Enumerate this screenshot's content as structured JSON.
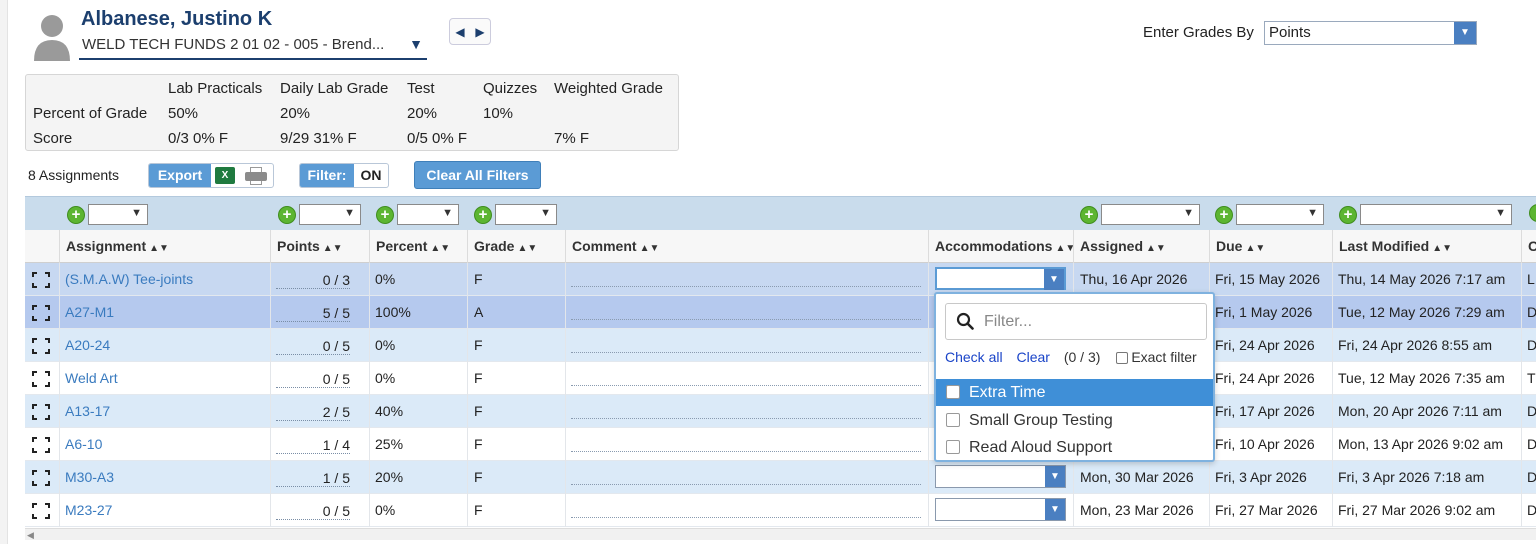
{
  "student": {
    "name": "Albanese, Justino K",
    "class_selector": "WELD TECH FUNDS 2 01 02 - 005 - Brend..."
  },
  "grades_by": {
    "label": "Enter Grades By",
    "value": "Points"
  },
  "summary": {
    "columns": [
      "Lab Practicals",
      "Daily Lab Grade",
      "Test",
      "Quizzes",
      "Weighted Grade"
    ],
    "percent_label": "Percent of Grade",
    "percents": [
      "50%",
      "20%",
      "20%",
      "10%",
      ""
    ],
    "score_label": "Score",
    "scores": [
      "0/3 0% F",
      "9/29 31% F",
      "0/5 0% F",
      "",
      "7% F"
    ]
  },
  "toolbar": {
    "assignment_count": "8 Assignments",
    "export_label": "Export",
    "excel_icon_text": "X",
    "filter_label": "Filter:",
    "filter_state": "ON",
    "clear_filters_label": "Clear All Filters"
  },
  "columns": [
    "Assignment",
    "Points",
    "Percent",
    "Grade",
    "Comment",
    "Accommodations",
    "Assigned",
    "Due",
    "Last Modified",
    "C"
  ],
  "rows": [
    {
      "assignment": "(S.M.A.W) Tee-joints",
      "points": "0 / 3",
      "percent": "0%",
      "grade": "F",
      "assigned": "Thu, 16 Apr 2026",
      "due": "Fri, 15 May 2026",
      "modified": "Thu, 14 May 2026 7:17 am",
      "cat": "L"
    },
    {
      "assignment": "A27-M1",
      "points": "5 / 5",
      "percent": "100%",
      "grade": "A",
      "assigned": "",
      "due": "Fri, 1 May 2026",
      "modified": "Tue, 12 May 2026 7:29 am",
      "cat": "D"
    },
    {
      "assignment": "A20-24",
      "points": "0 / 5",
      "percent": "0%",
      "grade": "F",
      "assigned": "",
      "due": "Fri, 24 Apr 2026",
      "modified": "Fri, 24 Apr 2026 8:55 am",
      "cat": "D"
    },
    {
      "assignment": "Weld Art",
      "points": "0 / 5",
      "percent": "0%",
      "grade": "F",
      "assigned": "",
      "due": "Fri, 24 Apr 2026",
      "modified": "Tue, 12 May 2026 7:35 am",
      "cat": "T"
    },
    {
      "assignment": "A13-17",
      "points": "2 / 5",
      "percent": "40%",
      "grade": "F",
      "assigned": "",
      "due": "Fri, 17 Apr 2026",
      "modified": "Mon, 20 Apr 2026 7:11 am",
      "cat": "D"
    },
    {
      "assignment": "A6-10",
      "points": "1 / 4",
      "percent": "25%",
      "grade": "F",
      "assigned": "",
      "due": "Fri, 10 Apr 2026",
      "modified": "Mon, 13 Apr 2026 9:02 am",
      "cat": "D"
    },
    {
      "assignment": "M30-A3",
      "points": "1 / 5",
      "percent": "20%",
      "grade": "F",
      "assigned": "Mon, 30 Mar 2026",
      "due": "Fri, 3 Apr 2026",
      "modified": "Fri, 3 Apr 2026 7:18 am",
      "cat": "D"
    },
    {
      "assignment": "M23-27",
      "points": "0 / 5",
      "percent": "0%",
      "grade": "F",
      "assigned": "Mon, 23 Mar 2026",
      "due": "Fri, 27 Mar 2026",
      "modified": "Fri, 27 Mar 2026 9:02 am",
      "cat": "D"
    }
  ],
  "dropdown": {
    "filter_placeholder": "Filter...",
    "check_all": "Check all",
    "clear": "Clear",
    "count": "(0 / 3)",
    "exact_filter": "Exact filter",
    "options": [
      "Extra Time",
      "Small Group Testing",
      "Read Aloud Support"
    ]
  },
  "colors": {
    "row_blue": "#dbeaf8",
    "row_white": "#ffffff",
    "row_selected": "#b5c9ee",
    "row_first": "#c7d8f1",
    "accent": "#5b9bd5",
    "link": "#3a7bbf"
  },
  "icons": {
    "avatar": "person-silhouette-icon",
    "prev": "chevron-left-icon",
    "next": "chevron-right-icon",
    "excel": "excel-icon",
    "print": "printer-icon",
    "add": "plus-circle-icon",
    "sort": "sort-arrows-icon",
    "expand": "expand-corners-icon",
    "search": "magnifier-icon"
  }
}
